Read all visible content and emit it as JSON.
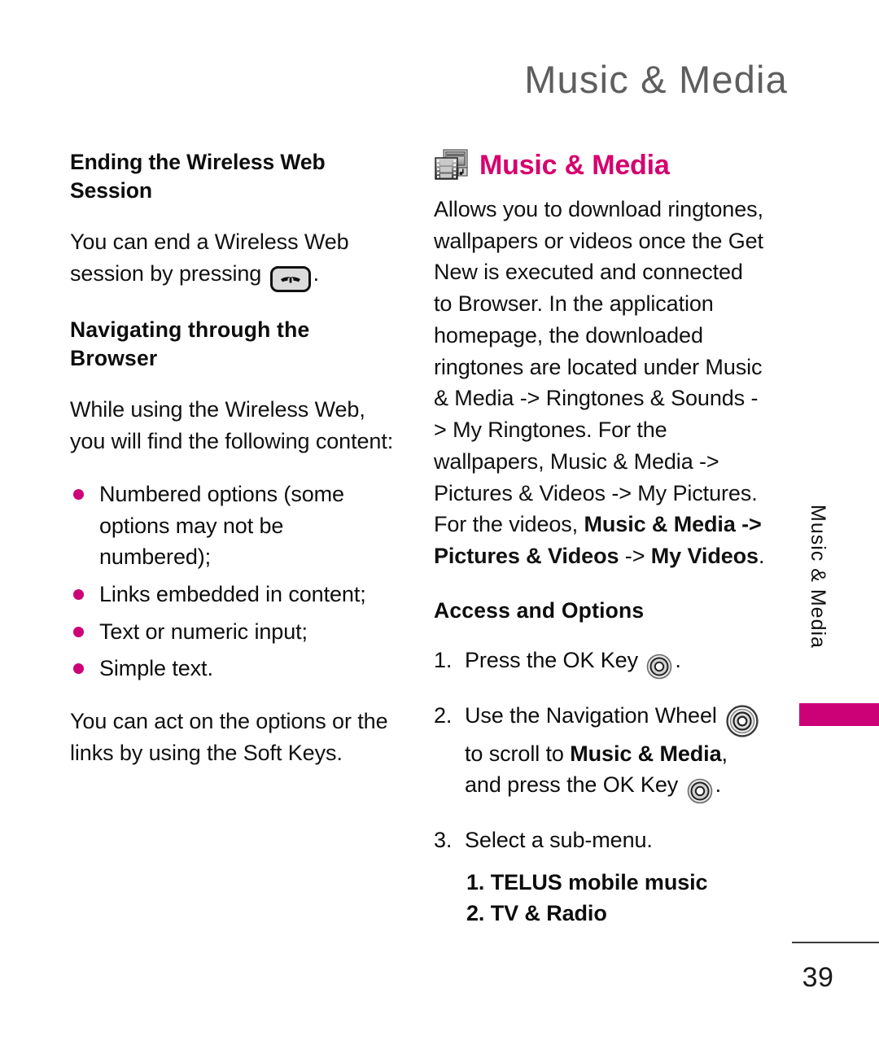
{
  "header": {
    "running_title": "Music & Media"
  },
  "left_column": {
    "heading_1": "Ending the Wireless Web Session",
    "paragraph_1_before_key": "You can end a Wireless Web session by pressing",
    "paragraph_1_after_key": ".",
    "end_key_icon": "end-call-key-icon",
    "heading_2": "Navigating through the Browser",
    "paragraph_2": "While using the Wireless Web, you will find the following content:",
    "bullets": [
      "Numbered options (some options may not be numbered);",
      "Links embedded in content;",
      "Text or numeric input;",
      "Simple text."
    ],
    "paragraph_3": "You can act on the options or the links by using the Soft Keys."
  },
  "right_column": {
    "section_icon": "music-media-film-icon",
    "section_title": "Music & Media",
    "intro_paragraph": "Allows you to download ringtones, wallpapers or videos once the Get New is executed and connected to Browser. In the application homepage, the downloaded ringtones are located under Music & Media -> Ringtones & Sounds -> My Ringtones. For the wallpapers, Music & Media -> Pictures & Videos -> My Pictures.",
    "videos_line_prefix": "For the videos, ",
    "videos_line_bold_1": "Music & Media",
    "videos_line_arrow_1": " -> ",
    "videos_line_bold_2": "Pictures & Videos",
    "videos_line_arrow_2": " -> ",
    "videos_line_bold_3": "My Videos",
    "videos_line_suffix": ".",
    "access_heading": "Access and Options",
    "steps": [
      {
        "number": "1.",
        "text_before": "Press the OK Key",
        "icon": "ok-key-icon",
        "text_after": "."
      },
      {
        "number": "2.",
        "text_before": "Use the Navigation Wheel",
        "icon": "navigation-wheel-icon",
        "text_mid": "to scroll to ",
        "bold_target": "Music & Media",
        "text_mid2": ",",
        "text_after_prefix": "and press the OK Key",
        "icon2": "ok-key-icon",
        "text_after": "."
      },
      {
        "number": "3.",
        "text_before": "Select a sub-menu.",
        "icon": "",
        "text_after": ""
      }
    ],
    "submenu_items": [
      "1. TELUS mobile music",
      "2. TV & Radio"
    ]
  },
  "side_tab": {
    "label": "Music & Media",
    "marker_color": "#cc0077"
  },
  "footer": {
    "page_number": "39"
  },
  "colors": {
    "accent_magenta": "#cc0077",
    "section_title_pink": "#d6006e",
    "running_header_gray": "#5e5e5e",
    "body_text": "#111111"
  }
}
